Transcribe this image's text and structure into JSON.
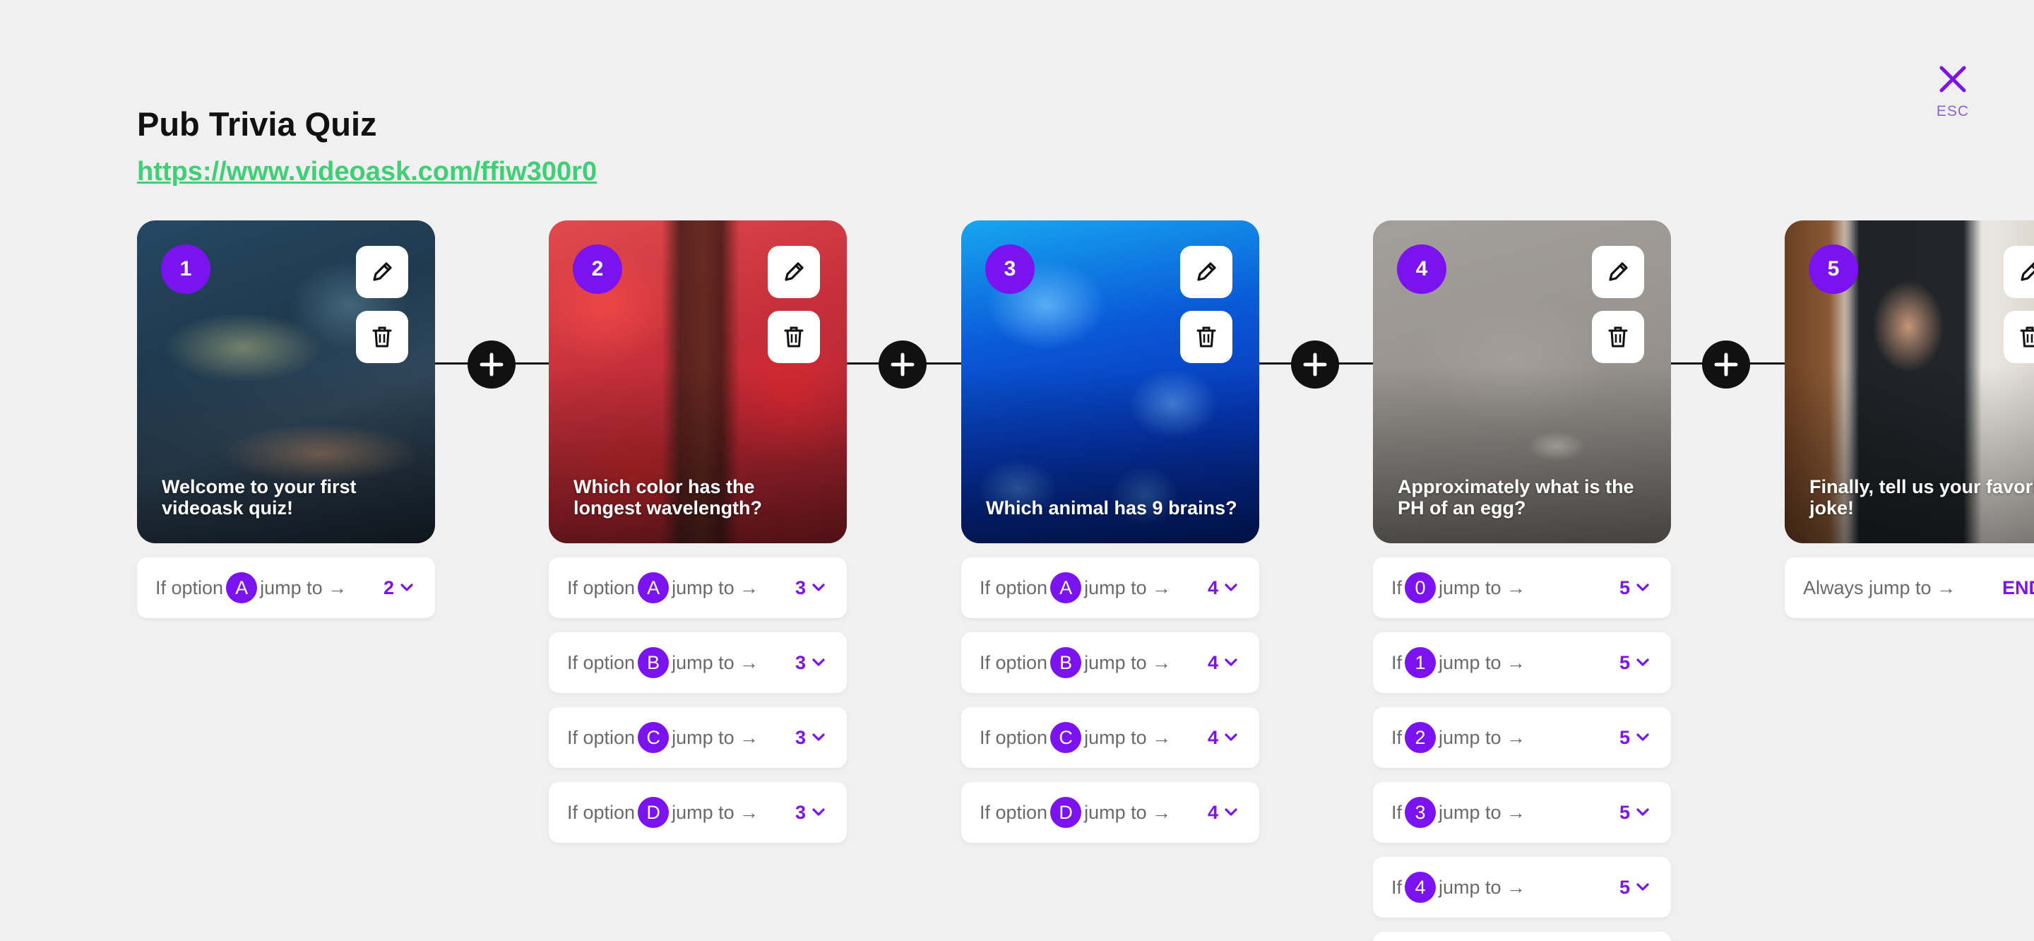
{
  "header": {
    "title": "Pub Trivia Quiz",
    "url": "https://www.videoask.com/ffiw300r0",
    "close_label": "ESC"
  },
  "colors": {
    "accent": "#7b12f0",
    "link": "#3fcf75",
    "background": "#f0f0f0"
  },
  "steps": [
    {
      "number": "1",
      "question": "Welcome to your first videoask quiz!",
      "rules": [
        {
          "prefix": "If option",
          "badge": "A",
          "suffix": "jump to →",
          "target": "2"
        }
      ]
    },
    {
      "number": "2",
      "question": "Which color has the longest wavelength?",
      "rules": [
        {
          "prefix": "If option",
          "badge": "A",
          "suffix": "jump to →",
          "target": "3"
        },
        {
          "prefix": "If option",
          "badge": "B",
          "suffix": "jump to →",
          "target": "3"
        },
        {
          "prefix": "If option",
          "badge": "C",
          "suffix": "jump to →",
          "target": "3"
        },
        {
          "prefix": "If option",
          "badge": "D",
          "suffix": "jump to →",
          "target": "3"
        }
      ]
    },
    {
      "number": "3",
      "question": "Which animal has 9 brains?",
      "rules": [
        {
          "prefix": "If option",
          "badge": "A",
          "suffix": "jump to →",
          "target": "4"
        },
        {
          "prefix": "If option",
          "badge": "B",
          "suffix": "jump to →",
          "target": "4"
        },
        {
          "prefix": "If option",
          "badge": "C",
          "suffix": "jump to →",
          "target": "4"
        },
        {
          "prefix": "If option",
          "badge": "D",
          "suffix": "jump to →",
          "target": "4"
        }
      ]
    },
    {
      "number": "4",
      "question": "Approximately what is the PH of an egg?",
      "rules": [
        {
          "prefix": "If",
          "badge": "0",
          "suffix": "jump to →",
          "target": "5"
        },
        {
          "prefix": "If",
          "badge": "1",
          "suffix": "jump to →",
          "target": "5"
        },
        {
          "prefix": "If",
          "badge": "2",
          "suffix": "jump to →",
          "target": "5"
        },
        {
          "prefix": "If",
          "badge": "3",
          "suffix": "jump to →",
          "target": "5"
        },
        {
          "prefix": "If",
          "badge": "4",
          "suffix": "jump to →",
          "target": "5"
        }
      ]
    },
    {
      "number": "5",
      "question": "Finally, tell us your favorite joke!",
      "rules": [
        {
          "prefix": "Always jump to →",
          "badge": "",
          "suffix": "",
          "target": "END"
        }
      ]
    }
  ]
}
